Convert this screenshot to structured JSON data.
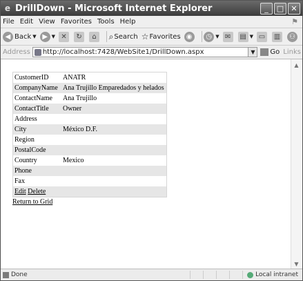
{
  "window": {
    "title": "DrillDown - Microsoft Internet Explorer"
  },
  "menu": [
    "File",
    "Edit",
    "View",
    "Favorites",
    "Tools",
    "Help"
  ],
  "toolbar": {
    "back": "Back",
    "search": "Search",
    "favorites": "Favorites"
  },
  "address": {
    "label": "Address",
    "url": "http://localhost:7428/WebSite1/DrillDown.aspx",
    "go": "Go",
    "links": "Links"
  },
  "details": [
    {
      "field": "CustomerID",
      "value": "ANATR"
    },
    {
      "field": "CompanyName",
      "value": "Ana Trujillo Emparedados y helados"
    },
    {
      "field": "ContactName",
      "value": "Ana Trujillo"
    },
    {
      "field": "ContactTitle",
      "value": "Owner"
    },
    {
      "field": "Address",
      "value": ""
    },
    {
      "field": "City",
      "value": "México D.F."
    },
    {
      "field": "Region",
      "value": ""
    },
    {
      "field": "PostalCode",
      "value": ""
    },
    {
      "field": "Country",
      "value": "Mexico"
    },
    {
      "field": "Phone",
      "value": ""
    },
    {
      "field": "Fax",
      "value": ""
    }
  ],
  "actions": {
    "edit": "Edit",
    "delete": "Delete"
  },
  "return_link": "Return to Grid",
  "status": {
    "left": "Done",
    "zone": "Local intranet"
  }
}
